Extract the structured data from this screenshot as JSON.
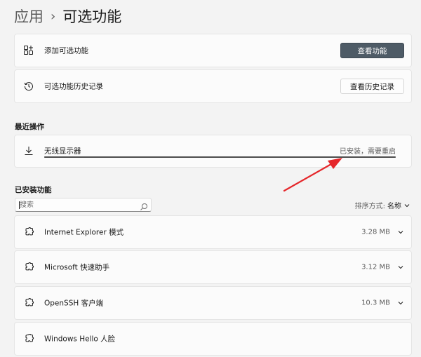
{
  "breadcrumb": {
    "parent": "应用",
    "separator": "›",
    "current": "可选功能"
  },
  "add_feature": {
    "label": "添加可选功能",
    "button": "查看功能",
    "icon": "add-grid-icon"
  },
  "history": {
    "label": "可选功能历史记录",
    "button": "查看历史记录",
    "icon": "history-icon"
  },
  "recent": {
    "title": "最近操作",
    "item": {
      "name": "无线显示器",
      "status": "已安装，需要重启",
      "progress": 1.0,
      "icon": "download-icon"
    }
  },
  "installed": {
    "title": "已安装功能",
    "search_placeholder": "搜索",
    "sort_label": "排序方式:",
    "sort_value": "名称",
    "features": [
      {
        "name": "Internet Explorer 模式",
        "size": "3.28 MB"
      },
      {
        "name": "Microsoft 快速助手",
        "size": "3.12 MB"
      },
      {
        "name": "OpenSSH 客户端",
        "size": "10.3 MB"
      },
      {
        "name": "Windows Hello 人脸",
        "size": ""
      }
    ]
  },
  "colors": {
    "accent_button": "#4e5b66",
    "annotation_arrow": "#e5262a",
    "background": "#f3f3f3"
  }
}
